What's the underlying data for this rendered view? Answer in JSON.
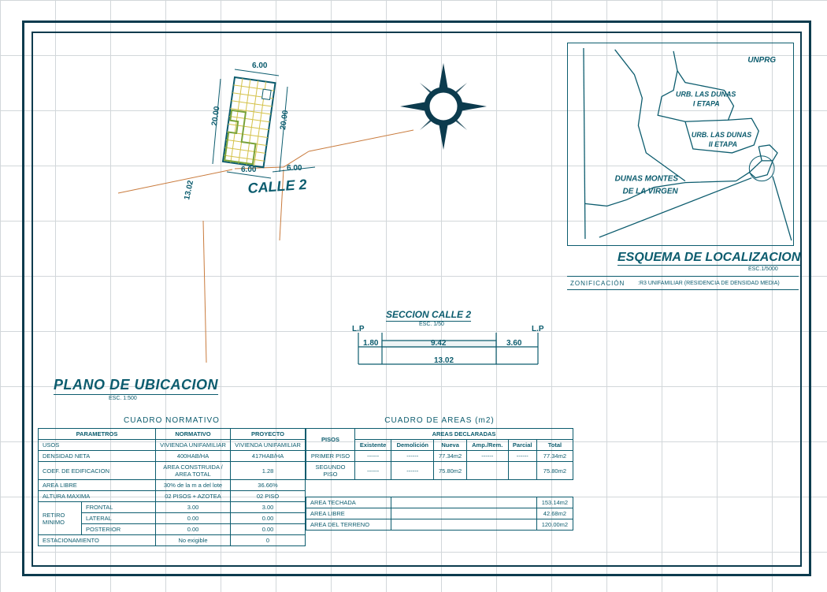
{
  "titles": {
    "ubicacion": "PLANO DE UBICACION",
    "ubicacion_esc": "ESC. 1:500",
    "localizacion": "ESQUEMA DE LOCALIZACION",
    "localizacion_esc": "ESC.1/5000",
    "seccion": "SECCION CALLE 2",
    "seccion_esc": "ESC. 1/50",
    "zon_label": "ZONIFICACIÓN",
    "zon_value": ":R3 UNIFAMILIAR (RESIDENCIA DE DENSIDAD MEDIA)"
  },
  "lot": {
    "street": "CALLE 2",
    "dim_top": "6.00",
    "dim_bottom_left": "6.00",
    "dim_bottom_right": "6.00",
    "dim_left": "20.00",
    "dim_right": "20.00",
    "street_width": "13.02"
  },
  "section": {
    "lp": "L.P",
    "left": "1.80",
    "mid": "9.42",
    "right": "3.60",
    "total": "13.02"
  },
  "locator": {
    "labels": {
      "unprg": "UNPRG",
      "dunas1a": "URB. LAS DUNAS",
      "dunas1b": "I ETAPA",
      "dunas2a": "URB. LAS DUNAS",
      "dunas2b": "II ETAPA",
      "main1": "DUNAS MONTES",
      "main2": "DE LA VIRGEN"
    }
  },
  "cuadro_normativo": {
    "title": "CUADRO NORMATIVO",
    "headers": {
      "param": "PARAMETROS",
      "norm": "NORMATIVO",
      "proy": "PROYECTO"
    },
    "rows": [
      {
        "param": "USOS",
        "norm": "VIVIENDA UNIFAMILIAR",
        "proy": "VIVIENDA UNIFAMILIAR"
      },
      {
        "param": "DENSIDAD NETA",
        "norm": "400HAB/HA",
        "proy": "417HAB/HA"
      },
      {
        "param": "COEF. DE EDIFICACION",
        "norm": "AREA CONSTRUIDA / AREA TOTAL",
        "proy": "1.28"
      },
      {
        "param": "AREA LIBRE",
        "norm": "30% de la m a del lote",
        "proy": "36.66%"
      },
      {
        "param": "ALTURA MAXIMA",
        "norm": "02 PISOS + AZOTEA",
        "proy": "02 PISO"
      }
    ],
    "retiro": {
      "label": "RETIRO MINIMO",
      "rows": [
        {
          "name": "FRONTAL",
          "norm": "3.00",
          "proy": "3.00"
        },
        {
          "name": "LATERAL",
          "norm": "0.00",
          "proy": "0.00"
        },
        {
          "name": "POSTERIOR",
          "norm": "0.00",
          "proy": "0.00"
        }
      ]
    },
    "estac": {
      "param": "ESTACIONAMIENTO",
      "norm": "No exigible",
      "proy": "0"
    }
  },
  "cuadro_areas": {
    "title": "CUADRO DE AREAS (m2)",
    "headers": {
      "pisos": "PISOS",
      "decl": "AREAS DECLARADAS",
      "exist": "Existente",
      "demol": "Demolición",
      "nueva": "Nueva",
      "amp": "Amp./Rem.",
      "parcial": "Parcial",
      "total": "Total"
    },
    "rows": [
      {
        "piso": "PRIMER PISO",
        "exist": "------",
        "demol": "------",
        "nueva": "77.34m2",
        "amp": "------",
        "parcial": "------",
        "total": "77.34m2"
      },
      {
        "piso": "SEGUNDO PISO",
        "exist": "------",
        "demol": "------",
        "nueva": "75.80m2",
        "amp": "",
        "parcial": "",
        "total": "75.80m2"
      }
    ],
    "summary": [
      {
        "label": "AREA TECHADA",
        "value": "153.14m2"
      },
      {
        "label": "AREA LIBRE",
        "value": "42.68m2"
      },
      {
        "label": "AREA DEL TERRENO",
        "value": "120.00m2"
      }
    ]
  }
}
